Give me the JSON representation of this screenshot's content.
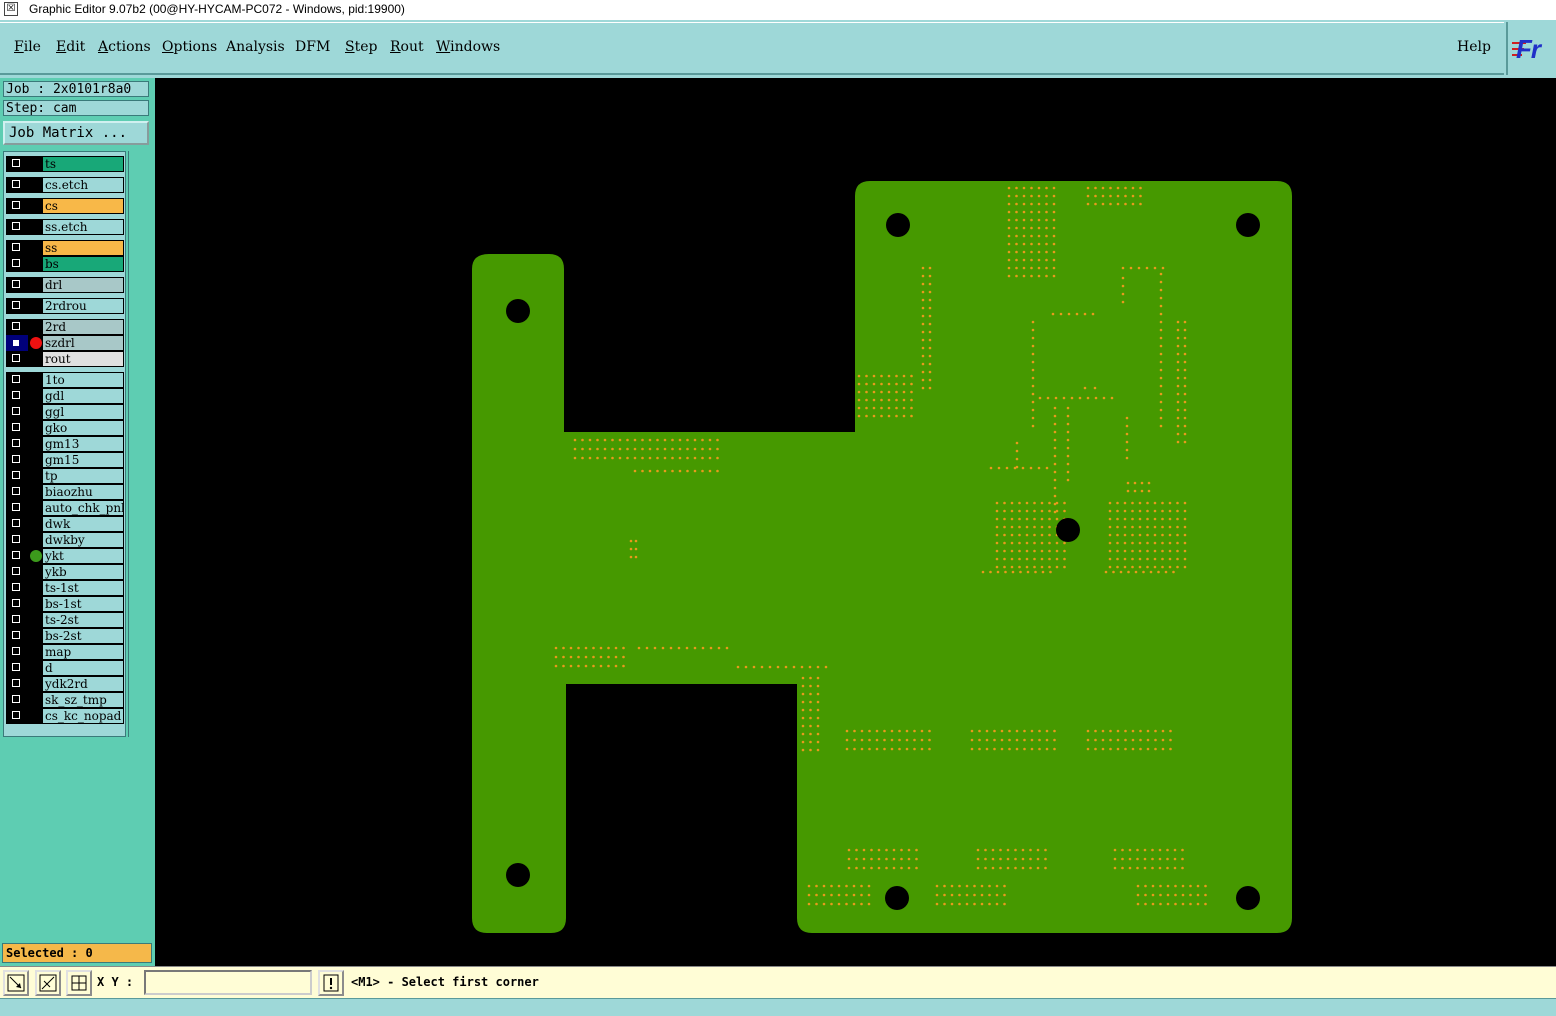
{
  "window": {
    "title": "Graphic Editor 9.07b2 (00@HY-HYCAM-PC072 - Windows, pid:19900)"
  },
  "menu": {
    "items": [
      {
        "label": "File",
        "u": "F",
        "rest": "ile"
      },
      {
        "label": "Edit",
        "u": "E",
        "rest": "dit"
      },
      {
        "label": "Actions",
        "u": "A",
        "rest": "ctions"
      },
      {
        "label": "Options",
        "u": "O",
        "rest": "ptions"
      },
      {
        "label": "Analysis",
        "u": "",
        "rest": "Analysis"
      },
      {
        "label": "DFM",
        "u": "",
        "rest": "DFM"
      },
      {
        "label": "Step",
        "u": "S",
        "rest": "tep"
      },
      {
        "label": "Rout",
        "u": "R",
        "rest": "out"
      },
      {
        "label": "Windows",
        "u": "W",
        "rest": "indows"
      }
    ],
    "help": "Help"
  },
  "logo": "Fr",
  "panel": {
    "job": "Job : 2x0101r8a0",
    "step": "Step: cam",
    "job_matrix": "Job Matrix ...",
    "selected": "Selected : 0"
  },
  "layers": [
    {
      "name": "ts",
      "color": "#18a878"
    },
    {
      "name": "cs.etch",
      "color": "#9ed8d8"
    },
    {
      "name": "cs",
      "color": "#f8b848"
    },
    {
      "name": "ss.etch",
      "color": "#9ed8d8"
    },
    {
      "name": "ss",
      "color": "#f8b848"
    },
    {
      "name": "bs",
      "color": "#18a878"
    },
    {
      "name": "drl",
      "color": "#a8c8c8"
    },
    {
      "name": "2rdrou",
      "color": "#9ed8d8"
    },
    {
      "name": "2rd",
      "color": "#a8c8c8"
    },
    {
      "name": "szdrl",
      "color": "#a8c8c8",
      "dot": "#ee1111",
      "active": true
    },
    {
      "name": "rout",
      "color": "#e0e0e0"
    },
    {
      "name": "1to",
      "color": "#9ed8d8"
    },
    {
      "name": "gdl",
      "color": "#9ed8d8"
    },
    {
      "name": "ggl",
      "color": "#9ed8d8"
    },
    {
      "name": "gko",
      "color": "#9ed8d8"
    },
    {
      "name": "gm13",
      "color": "#9ed8d8"
    },
    {
      "name": "gm15",
      "color": "#9ed8d8"
    },
    {
      "name": "tp",
      "color": "#9ed8d8"
    },
    {
      "name": "biaozhu",
      "color": "#9ed8d8"
    },
    {
      "name": "auto_chk_pnl",
      "color": "#9ed8d8"
    },
    {
      "name": "dwk",
      "color": "#9ed8d8"
    },
    {
      "name": "dwkby",
      "color": "#9ed8d8"
    },
    {
      "name": "ykt",
      "color": "#9ed8d8",
      "dot": "#3c9a1c"
    },
    {
      "name": "ykb",
      "color": "#9ed8d8"
    },
    {
      "name": "ts-1st",
      "color": "#9ed8d8"
    },
    {
      "name": "bs-1st",
      "color": "#9ed8d8"
    },
    {
      "name": "ts-2st",
      "color": "#9ed8d8"
    },
    {
      "name": "bs-2st",
      "color": "#9ed8d8"
    },
    {
      "name": "map",
      "color": "#9ed8d8"
    },
    {
      "name": "d",
      "color": "#9ed8d8"
    },
    {
      "name": "ydk2rd",
      "color": "#9ed8d8"
    },
    {
      "name": "sk_sz_tmp",
      "color": "#9ed8d8"
    },
    {
      "name": "cs_kc_nopad",
      "color": "#9ed8d8"
    }
  ],
  "status": {
    "xy_label": "X Y :",
    "xy_value": "",
    "prompt": "<M1> - Select first corner"
  },
  "colors": {
    "board": "#469900",
    "pads": "#e89a1c",
    "canvas": "#000000",
    "panel_bg": "#9ed8d8",
    "panel_dark": "#5ecdb2"
  }
}
